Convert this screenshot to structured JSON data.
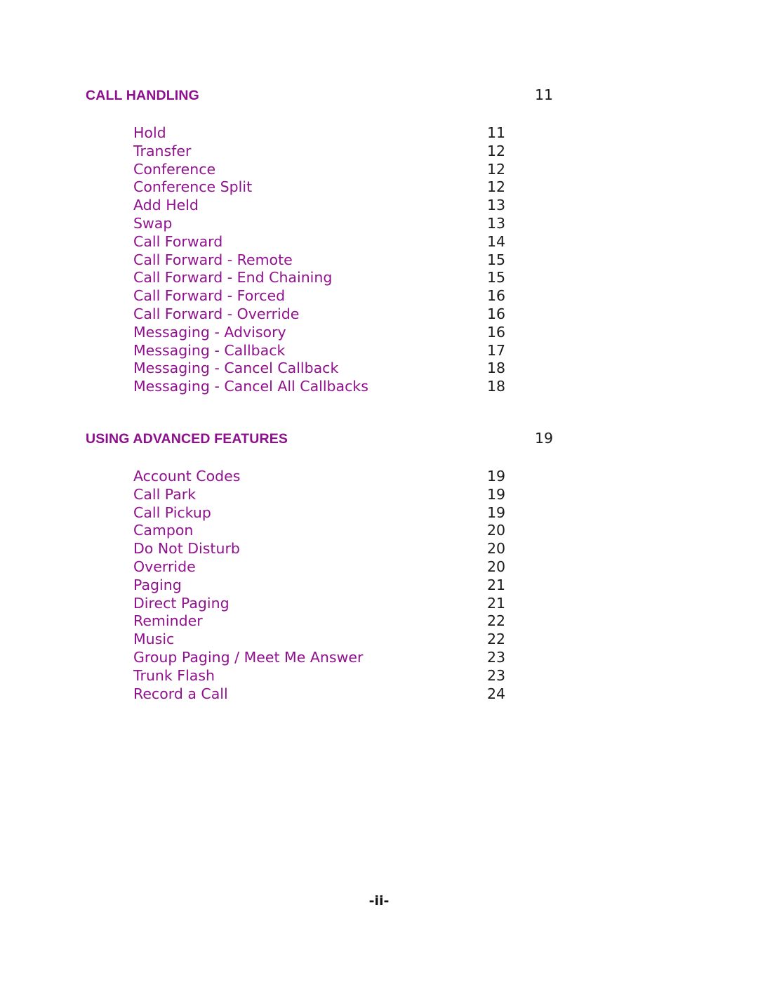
{
  "document": {
    "type": "table-of-contents",
    "footer_label": "-ii-",
    "colors": {
      "heading_purple": "#8d0f8d",
      "entry_purple": "#90118e",
      "page_number": "#1b1b1b",
      "background": "#ffffff"
    }
  },
  "sections": [
    {
      "title": "CALL HANDLING",
      "page": "11",
      "entries": [
        {
          "title": "Hold",
          "page": "11"
        },
        {
          "title": "Transfer",
          "page": "12"
        },
        {
          "title": "Conference",
          "page": "12"
        },
        {
          "title": "Conference Split",
          "page": "12"
        },
        {
          "title": "Add Held",
          "page": "13"
        },
        {
          "title": "Swap",
          "page": "13"
        },
        {
          "title": "Call Forward",
          "page": "14"
        },
        {
          "title": "Call Forward - Remote",
          "page": "15"
        },
        {
          "title": "Call Forward - End Chaining",
          "page": "15"
        },
        {
          "title": "Call Forward - Forced",
          "page": "16"
        },
        {
          "title": "Call Forward - Override",
          "page": "16"
        },
        {
          "title": "Messaging - Advisory",
          "page": "16"
        },
        {
          "title": "Messaging - Callback",
          "page": "17"
        },
        {
          "title": "Messaging - Cancel Callback",
          "page": "18"
        },
        {
          "title": "Messaging - Cancel All Callbacks",
          "page": "18"
        }
      ]
    },
    {
      "title": "USING ADVANCED FEATURES",
      "page": "19",
      "entries": [
        {
          "title": "Account Codes",
          "page": "19"
        },
        {
          "title": "Call Park",
          "page": "19"
        },
        {
          "title": "Call Pickup",
          "page": "19"
        },
        {
          "title": "Campon",
          "page": "20"
        },
        {
          "title": "Do Not Disturb",
          "page": "20"
        },
        {
          "title": "Override",
          "page": "20"
        },
        {
          "title": "Paging",
          "page": "21"
        },
        {
          "title": "Direct Paging",
          "page": "21"
        },
        {
          "title": "Reminder",
          "page": "22"
        },
        {
          "title": "Music",
          "page": "22"
        },
        {
          "title": "Group Paging / Meet Me Answer",
          "page": "23"
        },
        {
          "title": "Trunk Flash",
          "page": "23"
        },
        {
          "title": "Record a Call",
          "page": "24"
        }
      ]
    }
  ]
}
